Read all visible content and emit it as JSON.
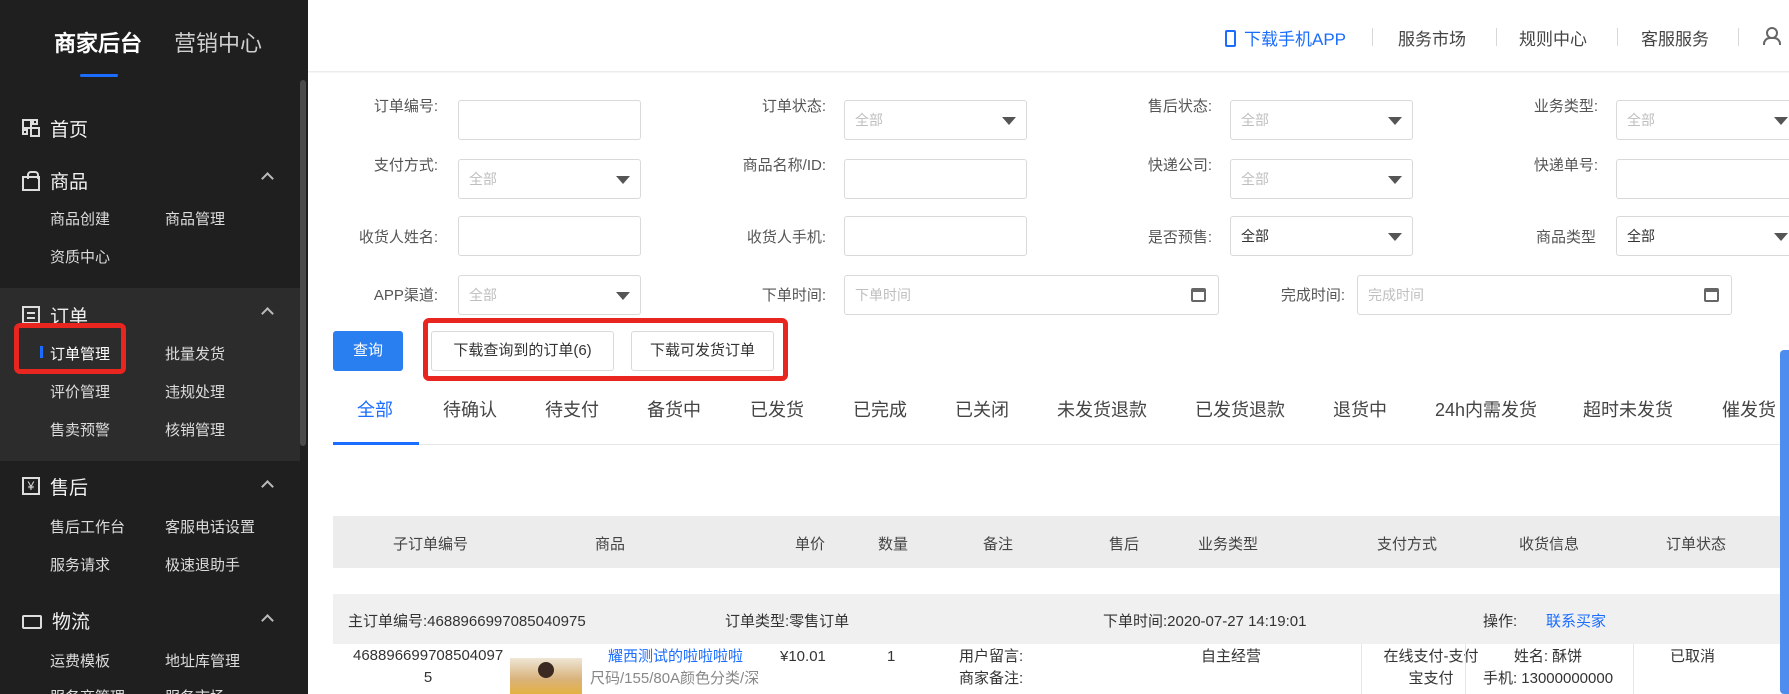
{
  "sidebar": {
    "tabs": [
      "商家后台",
      "营销中心"
    ],
    "sections": [
      {
        "title": "首页",
        "icon": "dashboard-grid-icon",
        "items": []
      },
      {
        "title": "商品",
        "icon": "shopping-bag-icon",
        "items": [
          "商品创建",
          "商品管理",
          "资质中心"
        ]
      },
      {
        "title": "订单",
        "icon": "order-document-icon",
        "items": [
          "订单管理",
          "批量发货",
          "评价管理",
          "违规处理",
          "售卖预警",
          "核销管理"
        ]
      },
      {
        "title": "售后",
        "icon": "after-sales-yen-icon",
        "items": [
          "售后工作台",
          "客服电话设置",
          "服务请求",
          "极速退助手"
        ]
      },
      {
        "title": "物流",
        "icon": "logistics-truck-icon",
        "items": [
          "运费模板",
          "地址库管理",
          "服务商管理",
          "服务市场"
        ]
      }
    ]
  },
  "topbar": {
    "download_app": "下载手机APP",
    "links": [
      "服务市场",
      "规则中心",
      "客服服务"
    ]
  },
  "filters": {
    "order_no": {
      "label": "订单编号:",
      "value": ""
    },
    "order_status": {
      "label": "订单状态:",
      "placeholder": "全部"
    },
    "after_sale_status": {
      "label": "售后状态:",
      "placeholder": "全部"
    },
    "business_type": {
      "label": "业务类型:",
      "placeholder": "全部"
    },
    "pay_method": {
      "label": "支付方式:",
      "placeholder": "全部"
    },
    "product_name": {
      "label": "商品名称/ID:",
      "value": ""
    },
    "courier": {
      "label": "快递公司:",
      "placeholder": "全部"
    },
    "tracking_no": {
      "label": "快递单号:",
      "value": ""
    },
    "receiver_name": {
      "label": "收货人姓名:",
      "value": ""
    },
    "receiver_phone": {
      "label": "收货人手机:",
      "value": ""
    },
    "presale": {
      "label": "是否预售:",
      "value": "全部"
    },
    "product_type": {
      "label": "商品类型",
      "value": "全部"
    },
    "app_channel": {
      "label": "APP渠道:",
      "placeholder": "全部"
    },
    "order_time": {
      "label": "下单时间:",
      "placeholder": "下单时间"
    },
    "complete_time": {
      "label": "完成时间:",
      "placeholder": "完成时间"
    }
  },
  "actions": {
    "query": "查询",
    "download_queried": "下载查询到的订单(6)",
    "download_shippable": "下载可发货订单"
  },
  "tabs": [
    "全部",
    "待确认",
    "待支付",
    "备货中",
    "已发货",
    "已完成",
    "已关闭",
    "未发货退款",
    "已发货退款",
    "退货中",
    "24h内需发货",
    "超时未发货",
    "催发货"
  ],
  "table": {
    "headers": [
      "子订单编号",
      "商品",
      "单价",
      "数量",
      "备注",
      "售后",
      "业务类型",
      "支付方式",
      "收货信息",
      "订单状态"
    ],
    "order": {
      "main_no_label": "主订单编号:",
      "main_no": "4688966997085040975",
      "type_label": "订单类型:",
      "type": "零售订单",
      "time_label": "下单时间:",
      "time": "2020-07-27 14:19:01",
      "op_label": "操作:",
      "op_link": "联系买家",
      "sub_no_line1": "468896699708504097",
      "sub_no_line2": "5",
      "product_title": "耀西测试的啦啦啦啦",
      "product_spec": "尺码/155/80A颜色分类/深",
      "price": "¥10.01",
      "qty": "1",
      "remark_user": "用户留言:",
      "remark_merchant": "商家备注:",
      "business_type": "自主经营",
      "pay_line1": "在线支付-支付",
      "pay_line2": "宝支付",
      "recv_name": "姓名: 酥饼",
      "recv_phone": "手机: 13000000000",
      "status": "已取消"
    }
  }
}
